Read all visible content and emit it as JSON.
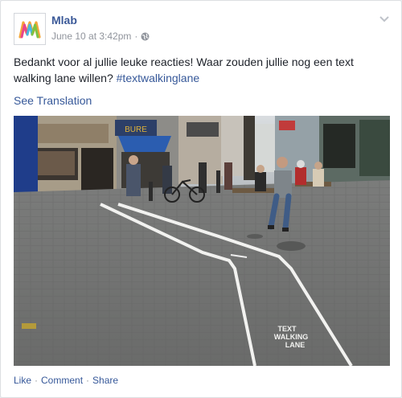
{
  "post": {
    "author": "Mlab",
    "timestamp": "June 10 at 3:42pm",
    "separator": "·",
    "privacy_icon": "globe-icon",
    "text": "Bedankt voor al jullie leuke reacties! Waar zouden jullie nog een text walking lane willen?",
    "hashtag": "#textwalkinglane",
    "see_translation": "See Translation",
    "photo": {
      "lane_label_line1": "TEXT",
      "lane_label_line2": "WALKING",
      "lane_label_line3": "LANE",
      "shop_sign": "BURE"
    }
  },
  "actions": {
    "like": "Like",
    "comment": "Comment",
    "share": "Share",
    "separator": "·"
  },
  "colors": {
    "link": "#365899",
    "author": "#3b5998",
    "meta": "#90949c"
  }
}
